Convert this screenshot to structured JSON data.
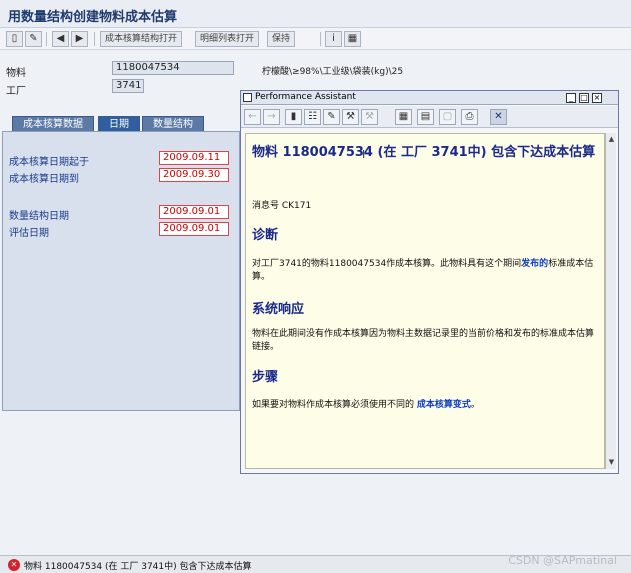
{
  "window": {
    "title": "用数量结构创建物料成本估算"
  },
  "toolbar": {
    "btn_costing_structure": "成本核算结构打开",
    "btn_detail_list": "明细列表打开",
    "btn_hold": "保持"
  },
  "header": {
    "material_label": "物料",
    "material_value": "1180047534",
    "material_desc": "柠檬酸\\≥98%\\工业级\\袋装(kg)\\25",
    "plant_label": "工厂",
    "plant_value": "3741"
  },
  "tabs": [
    "成本核算数据",
    "日期",
    "数量结构"
  ],
  "dates": {
    "costing_from_label": "成本核算日期起于",
    "costing_from_value": "2009.09.11",
    "costing_to_label": "成本核算日期到",
    "costing_to_value": "2009.09.30",
    "qty_struct_label": "数量结构日期",
    "qty_struct_value": "2009.09.01",
    "valuation_label": "评估日期",
    "valuation_value": "2009.09.01"
  },
  "assistant": {
    "title": "Performance Assistant",
    "heading": "物料 1180047534 (在 工厂 3741中) 包含下达成本估算",
    "message_no": "消息号 CK171",
    "diagnosis_title": "诊断",
    "diagnosis_text_1": "对工厂3741的物料1180047534作成本核算。此物料具有这个期间",
    "diagnosis_link": "发布的",
    "diagnosis_text_2": "标准成本估算。",
    "system_title": "系统响应",
    "system_text": "物料在此期间没有作成本核算因为物料主数据记录里的当前价格和发布的标准成本估算链接。",
    "procedure_title": "步骤",
    "procedure_text": "如果要对物料作成本核算必须使用不同的",
    "procedure_link": "成本核算变式",
    "procedure_end": "。"
  },
  "status": {
    "message": "物料 1180047534 (在 工厂 3741中) 包含下达成本估算"
  },
  "watermark": "CSDN @SAPmatinal"
}
